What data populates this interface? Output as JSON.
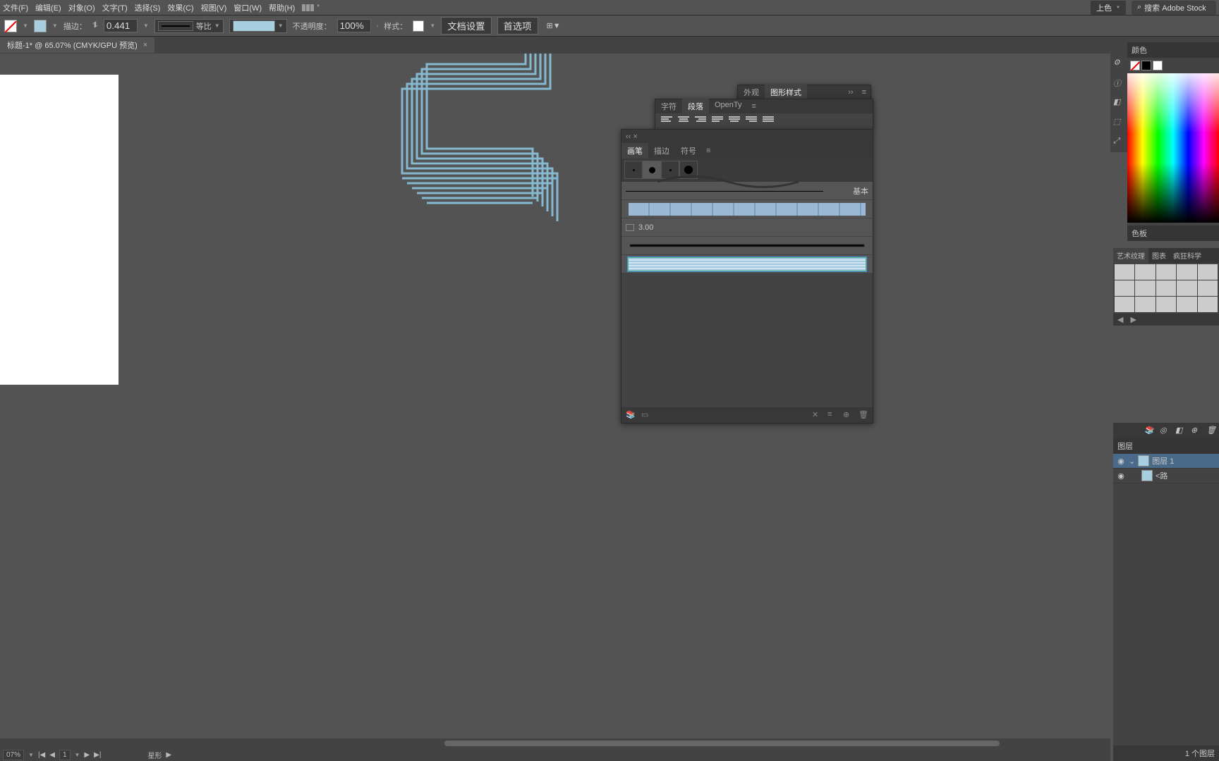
{
  "menubar": {
    "file": "文件(F)",
    "edit": "编辑(E)",
    "object": "对象(O)",
    "type": "文字(T)",
    "select": "选择(S)",
    "effect": "效果(C)",
    "view": "视图(V)",
    "window": "窗口(W)",
    "help": "帮助(H)",
    "paint_mode": "上色",
    "search_placeholder": "搜索 Adobe Stock"
  },
  "controlbar": {
    "stroke_label": "描边：",
    "stroke_weight": "0.441 ",
    "profile": "等比",
    "opacity_label": "不透明度：",
    "opacity": "100%",
    "style_label": "样式：",
    "doc_setup": "文档设置",
    "prefs": "首选项"
  },
  "document": {
    "tab_title": "标题-1* @ 65.07% (CMYK/GPU 预览)"
  },
  "panels": {
    "appearance": {
      "tab1": "外观",
      "tab2": "图形样式"
    },
    "type": {
      "tab1": "字符",
      "tab2": "段落",
      "tab3": "OpenTy"
    },
    "brushes": {
      "tab1": "画笔",
      "tab2": "描边",
      "tab3": "符号",
      "basic": "基本",
      "calligraphic_size": "3.00"
    },
    "color": {
      "title": "颜色",
      "title2": "色板"
    },
    "swatchlib": {
      "tab1": "艺术纹理",
      "tab2": "图表",
      "tab3": "疯狂科学"
    },
    "layers": {
      "title": "图层",
      "layer1": "图层 1",
      "path": "<路",
      "status": "1 个图层"
    }
  },
  "statusbar": {
    "zoom": "07%",
    "artboard": "1",
    "tool": "星形"
  }
}
